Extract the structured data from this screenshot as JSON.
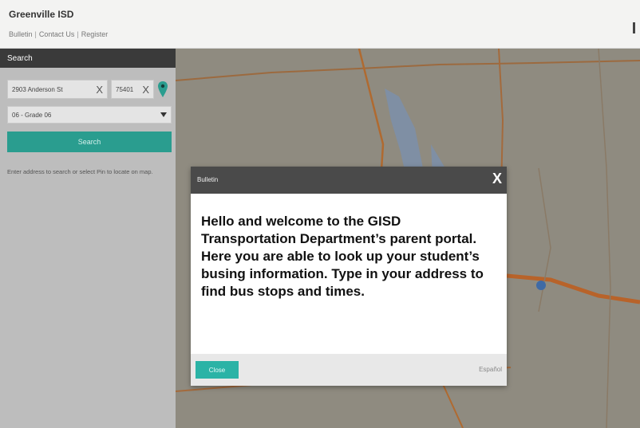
{
  "header": {
    "title": "Greenville ISD",
    "links": [
      "Bulletin",
      "Contact Us",
      "Register"
    ]
  },
  "sidebar": {
    "search_title": "Search",
    "address_value": "2903 Anderson St",
    "zip_value": "75401",
    "grade_value": "06 - Grade 06",
    "search_button": "Search",
    "hint": "Enter address to search or select Pin to locate on map."
  },
  "modal": {
    "title": "Bulletin",
    "close_icon": "X",
    "message": "Hello and welcome to the GISD Transportation Department’s parent portal. Here you are able to look up your student’s busing information. Type in your address to find bus stops and times.",
    "close_button": "Close",
    "language_link": "Español"
  },
  "colors": {
    "accent": "#2a9d8f",
    "header_dark": "#3a3a3a",
    "map_road": "#b86a2c",
    "pin": "#2a9d8f"
  },
  "icons": {
    "pin": "map-pin-icon",
    "clear": "clear-x-icon",
    "dropdown": "chevron-down-icon",
    "close": "close-icon"
  }
}
